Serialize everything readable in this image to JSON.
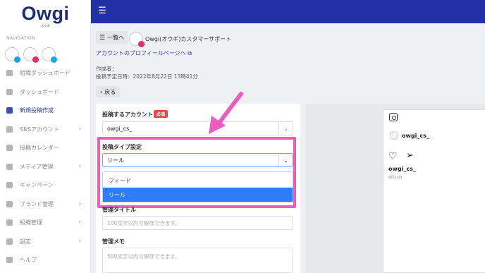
{
  "app": {
    "logo_text": "Owgi",
    "logo_sub": "オウギ",
    "brand_color": "#2230a8",
    "accent_pink": "#ea5dbf"
  },
  "sidebar": {
    "section_label": "NAVIGATION",
    "items": [
      {
        "label": "組織ダッシュボード",
        "icon": "building-icon",
        "chevron": false
      },
      {
        "label": "ダッシュボード",
        "icon": "grid-icon",
        "chevron": false
      },
      {
        "label": "新規投稿作成",
        "icon": "edit-icon",
        "chevron": false,
        "active": true
      },
      {
        "label": "SNSアカウント",
        "icon": "accounts-icon",
        "chevron": true
      },
      {
        "label": "投稿カレンダー",
        "icon": "calendar-icon",
        "chevron": false
      },
      {
        "label": "メディア管理",
        "icon": "media-icon",
        "chevron": true
      },
      {
        "label": "キャンペーン",
        "icon": "trophy-icon",
        "chevron": false
      },
      {
        "label": "ブランド管理",
        "icon": "brand-icon",
        "chevron": true
      },
      {
        "label": "組織管理",
        "icon": "org-icon",
        "chevron": true
      },
      {
        "label": "設定",
        "icon": "gear-icon",
        "chevron": true
      },
      {
        "label": "ヘルプ",
        "icon": "help-icon",
        "chevron": false
      }
    ],
    "chevron_glyph": "›"
  },
  "header": {
    "back_to_list": "一覧へ",
    "account_name": "Owgi(オウギ)カスタマーサポート",
    "profile_link": "アカウントのプロフィールページへ",
    "author": "作成者：",
    "schedule": "投稿予定日時：2022年8月22日 13時41分",
    "back_button": "戻る"
  },
  "form": {
    "account_label": "投稿するアカウント",
    "required_badge": "必須",
    "account_value": "owgi_cs_",
    "post_type_label": "投稿タイプ設定",
    "post_type_value": "リール",
    "post_type_options": [
      "フィード",
      "リール"
    ],
    "post_type_selected_index": 1,
    "title_label": "管理タイトル",
    "title_placeholder": "100文字以内で保存できます。",
    "memo_label": "管理メモ",
    "memo_placeholder": "500文字以内で保存できます。"
  },
  "preview": {
    "username": "owgi_cs_",
    "caption_user": "owgi_cs_",
    "date": "8月22日"
  }
}
